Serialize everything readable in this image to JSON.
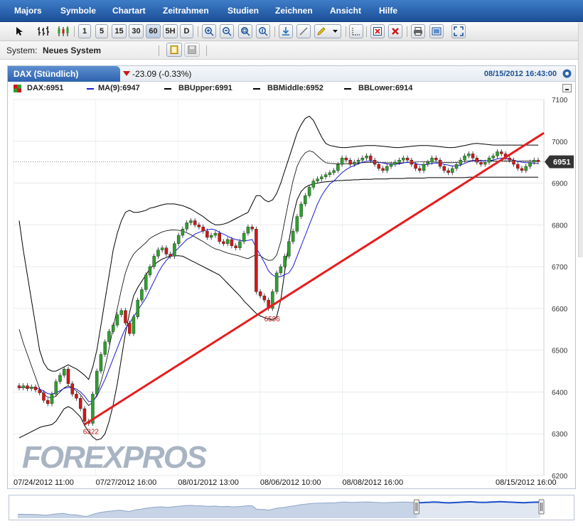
{
  "menu": [
    "Majors",
    "Symbole",
    "Chartart",
    "Zeitrahmen",
    "Studien",
    "Zeichnen",
    "Ansicht",
    "Hilfe"
  ],
  "toolbar": {
    "timeframes": [
      "1",
      "5",
      "15",
      "30",
      "60",
      "5H",
      "D"
    ]
  },
  "system": {
    "label": "System:",
    "value": "Neues System"
  },
  "tab": {
    "symbol": "DAX (Stündlich)",
    "change": "-23.09 (-0.33%)",
    "timestamp": "08/15/2012 16:43:00"
  },
  "legend": [
    {
      "text": "DAX:6951",
      "color": "#d40000"
    },
    {
      "text": "MA(9):6947",
      "color": "#1a1ad6"
    },
    {
      "text": "BBUpper:6991",
      "color": "#000000"
    },
    {
      "text": "BBMiddle:6952",
      "color": "#000000"
    },
    {
      "text": "BBLower:6914",
      "color": "#000000"
    }
  ],
  "colors": {
    "up": "#2ca02c",
    "down": "#d41515",
    "ma": "#1a1ad6",
    "bands": "#000000",
    "trendline": "#e81c1c",
    "lastprice_bg": "#333333",
    "watermark": "#9aa7b8"
  },
  "watermark": "FOREXPROS",
  "chart_data": {
    "type": "candlestick",
    "ylim": [
      6200,
      7100
    ],
    "yticks": [
      "7100",
      "7000",
      "6900",
      "6800",
      "6700",
      "6600",
      "6500",
      "6400",
      "6300",
      "6200"
    ],
    "xticks": [
      "07/24/2012 11:00",
      "07/27/2012 16:00",
      "08/01/2012 13:00",
      "08/06/2012 10:00",
      "08/08/2012 16:00",
      "08/15/2012 16:00"
    ],
    "last_price": "6951",
    "annotations": [
      {
        "text": "6322",
        "value": 6322
      },
      {
        "text": "6596",
        "value": 6596
      }
    ],
    "trendline": {
      "from": 6322,
      "to": 7020
    },
    "close": [
      6410,
      6415,
      6408,
      6412,
      6405,
      6398,
      6380,
      6372,
      6395,
      6425,
      6440,
      6455,
      6420,
      6395,
      6385,
      6360,
      6330,
      6325,
      6395,
      6450,
      6490,
      6520,
      6545,
      6560,
      6585,
      6595,
      6565,
      6540,
      6580,
      6620,
      6645,
      6680,
      6700,
      6725,
      6740,
      6745,
      6730,
      6725,
      6755,
      6775,
      6790,
      6805,
      6810,
      6800,
      6795,
      6785,
      6770,
      6775,
      6780,
      6760,
      6755,
      6765,
      6750,
      6745,
      6760,
      6780,
      6795,
      6790,
      6640,
      6630,
      6620,
      6600,
      6640,
      6685,
      6700,
      6725,
      6760,
      6785,
      6820,
      6850,
      6870,
      6890,
      6905,
      6910,
      6915,
      6920,
      6925,
      6930,
      6945,
      6960,
      6955,
      6945,
      6950,
      6955,
      6960,
      6965,
      6955,
      6945,
      6935,
      6930,
      6940,
      6945,
      6950,
      6955,
      6960,
      6955,
      6945,
      6935,
      6930,
      6945,
      6950,
      6960,
      6955,
      6940,
      6930,
      6925,
      6935,
      6945,
      6955,
      6965,
      6970,
      6960,
      6950,
      6945,
      6950,
      6960,
      6965,
      6975,
      6970,
      6960,
      6955,
      6945,
      6935,
      6930,
      6940,
      6950,
      6955,
      6951
    ],
    "ma9": [
      6410,
      6411,
      6411,
      6411,
      6410,
      6407,
      6402,
      6396,
      6395,
      6398,
      6403,
      6409,
      6411,
      6410,
      6407,
      6400,
      6390,
      6377,
      6378,
      6390,
      6410,
      6430,
      6455,
      6480,
      6505,
      6530,
      6552,
      6565,
      6580,
      6595,
      6610,
      6625,
      6645,
      6665,
      6685,
      6702,
      6715,
      6725,
      6735,
      6745,
      6755,
      6765,
      6770,
      6778,
      6782,
      6786,
      6788,
      6790,
      6788,
      6782,
      6778,
      6773,
      6768,
      6765,
      6763,
      6762,
      6763,
      6765,
      6745,
      6728,
      6710,
      6690,
      6680,
      6675,
      6676,
      6681,
      6685,
      6700,
      6725,
      6750,
      6775,
      6800,
      6825,
      6850,
      6870,
      6885,
      6898,
      6905,
      6915,
      6925,
      6932,
      6938,
      6942,
      6946,
      6950,
      6952,
      6953,
      6952,
      6950,
      6948,
      6946,
      6945,
      6945,
      6946,
      6948,
      6950,
      6949,
      6947,
      6944,
      6944,
      6945,
      6947,
      6948,
      6947,
      6945,
      6943,
      6941,
      6941,
      6943,
      6947,
      6951,
      6953,
      6953,
      6953,
      6953,
      6954,
      6955,
      6958,
      6960,
      6959,
      6957,
      6955,
      6952,
      6950,
      6949,
      6948,
      6947,
      6947
    ],
    "bb_upper": [
      6810,
      6740,
      6680,
      6620,
      6560,
      6500,
      6470,
      6455,
      6450,
      6450,
      6455,
      6460,
      6465,
      6460,
      6455,
      6448,
      6440,
      6430,
      6460,
      6500,
      6560,
      6620,
      6680,
      6740,
      6780,
      6810,
      6830,
      6835,
      6830,
      6830,
      6832,
      6835,
      6840,
      6842,
      6845,
      6848,
      6850,
      6850,
      6850,
      6848,
      6846,
      6842,
      6838,
      6832,
      6826,
      6820,
      6812,
      6805,
      6800,
      6800,
      6802,
      6805,
      6810,
      6815,
      6820,
      6825,
      6830,
      6850,
      6870,
      6870,
      6860,
      6855,
      6860,
      6875,
      6900,
      6930,
      6960,
      6990,
      7020,
      7040,
      7055,
      7060,
      7050,
      7030,
      7010,
      6995,
      6990,
      6988,
      6986,
      6985,
      6985,
      6986,
      6987,
      6988,
      6989,
      6990,
      6990,
      6990,
      6989,
      6988,
      6987,
      6986,
      6985,
      6985,
      6986,
      6987,
      6988,
      6989,
      6990,
      6990,
      6990,
      6989,
      6988,
      6987,
      6986,
      6985,
      6985,
      6986,
      6988,
      6990,
      6992,
      6994,
      6995,
      6994,
      6993,
      6992,
      6991,
      6991,
      6991,
      6991,
      6991,
      6991,
      6991,
      6991,
      6991,
      6991,
      6991,
      6991
    ],
    "bb_lower": [
      6290,
      6295,
      6300,
      6305,
      6310,
      6315,
      6318,
      6320,
      6322,
      6330,
      6345,
      6360,
      6365,
      6360,
      6350,
      6340,
      6320,
      6305,
      6292,
      6285,
      6288,
      6300,
      6330,
      6370,
      6420,
      6480,
      6540,
      6590,
      6630,
      6650,
      6665,
      6680,
      6695,
      6705,
      6712,
      6718,
      6722,
      6725,
      6726,
      6726,
      6725,
      6720,
      6715,
      6710,
      6705,
      6700,
      6695,
      6690,
      6685,
      6680,
      6670,
      6660,
      6650,
      6640,
      6630,
      6618,
      6608,
      6598,
      6588,
      6582,
      6578,
      6575,
      6572,
      6580,
      6620,
      6690,
      6760,
      6820,
      6860,
      6880,
      6890,
      6895,
      6898,
      6900,
      6902,
      6903,
      6904,
      6905,
      6906,
      6906,
      6907,
      6907,
      6908,
      6908,
      6909,
      6909,
      6909,
      6910,
      6910,
      6910,
      6910,
      6911,
      6911,
      6911,
      6911,
      6912,
      6912,
      6912,
      6912,
      6912,
      6913,
      6913,
      6913,
      6913,
      6913,
      6913,
      6913,
      6913,
      6913,
      6913,
      6914,
      6914,
      6914,
      6914,
      6914,
      6914,
      6914,
      6914,
      6914,
      6914,
      6914,
      6914,
      6914,
      6914,
      6914,
      6914,
      6914,
      6914
    ]
  }
}
